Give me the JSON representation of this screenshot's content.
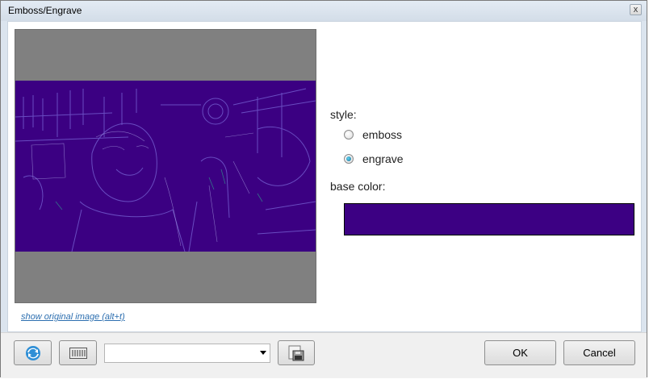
{
  "window": {
    "title": "Emboss/Engrave",
    "close_glyph": "x"
  },
  "preview": {
    "show_original_link": "show original image (alt+t)"
  },
  "options": {
    "style_label": "style:",
    "styles": [
      {
        "label": "emboss",
        "checked": false
      },
      {
        "label": "engrave",
        "checked": true
      }
    ],
    "base_color_label": "base color:",
    "base_color": "#3c0083"
  },
  "footer": {
    "refresh_icon": "refresh-icon",
    "slider_icon": "sliders-icon",
    "preset_value": "",
    "save_icon": "save-preset-icon",
    "ok_label": "OK",
    "cancel_label": "Cancel"
  }
}
